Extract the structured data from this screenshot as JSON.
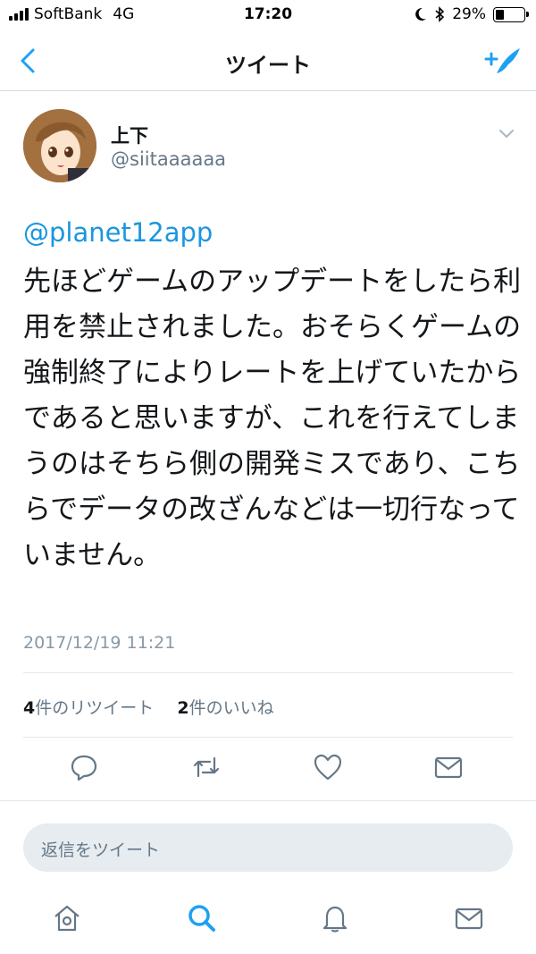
{
  "status_bar": {
    "carrier": "SoftBank",
    "network": "4G",
    "time": "17:20",
    "battery": "29%",
    "battery_level": 0.29
  },
  "nav": {
    "title": "ツイート"
  },
  "tweet": {
    "display_name": "上下",
    "handle": "@siitaaaaaa",
    "mention": "@planet12app",
    "text": "先ほどゲームのアップデートをしたら利用を禁止されました。おそらくゲームの強制終了によりレートを上げていたからであると思いますが、これを行えてしまうのはそちら側の開発ミスであり、こちらでデータの改ざんなどは一切行なっていません。",
    "timestamp": "2017/12/19 11:21"
  },
  "stats": {
    "retweet_count": "4",
    "retweet_label": "件のリツイート",
    "like_count": "2",
    "like_label": "件のいいね"
  },
  "actions": {
    "icons": [
      "reply-icon",
      "retweet-icon",
      "like-icon",
      "direct-message-icon"
    ]
  },
  "reply": {
    "placeholder": "返信をツイート"
  },
  "tab_bar": {
    "icons": [
      "home-icon",
      "search-icon",
      "notifications-icon",
      "messages-icon"
    ]
  },
  "colors": {
    "accent": "#1da1f2",
    "link": "#1b95e0",
    "icon_gray": "#657786",
    "divider": "#e1e8ed"
  }
}
